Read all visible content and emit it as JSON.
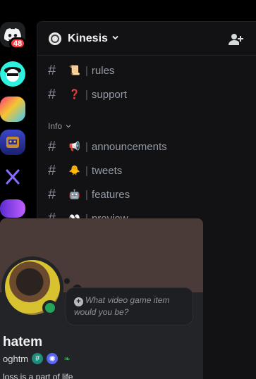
{
  "rail": {
    "unread_badge": "48",
    "colors": {
      "discord": "#1e1f22",
      "badge": "#f23f43"
    }
  },
  "server": {
    "name": "Kinesis",
    "channels_top": [
      {
        "emoji": "📜",
        "name": "rules"
      },
      {
        "emoji": "❓",
        "name": "support"
      }
    ],
    "category": "Info",
    "channels_info": [
      {
        "emoji": "📢",
        "name": "announcements"
      },
      {
        "emoji": "🐥",
        "name": "tweets"
      },
      {
        "emoji": "🤖",
        "name": "features"
      },
      {
        "emoji": "👀",
        "name": "preview"
      }
    ]
  },
  "profile": {
    "prompt": "What video game item would you be?",
    "display_name": "hatem",
    "username": "oghtm",
    "bio": "loss is a part of life",
    "status_color": "#23a55a"
  }
}
